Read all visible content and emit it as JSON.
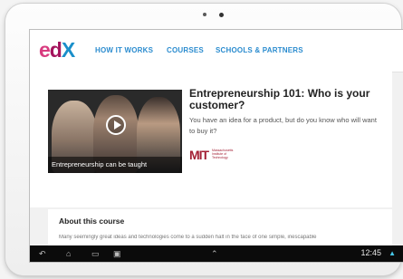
{
  "header": {
    "logo": {
      "e": "e",
      "d": "d",
      "x": "X"
    },
    "nav": [
      "HOW IT WORKS",
      "COURSES",
      "SCHOOLS & PARTNERS"
    ]
  },
  "course": {
    "video_caption": "Entrepreneurship can be taught",
    "title": "Entrepreneurship 101: Who is your customer?",
    "description": "You have an idea for a product, but do you know who will want to buy it?",
    "school_logo": {
      "mark": "MIT",
      "text": "Massachusetts Institute of Technology"
    }
  },
  "about": {
    "title": "About this course",
    "text": "Many seemingly great ideas and technologies come to a sudden halt in the face of one simple, inescapable"
  },
  "statusbar": {
    "time": "12:45",
    "icons": [
      "back-icon",
      "home-icon",
      "recent-apps-icon",
      "screenshot-icon",
      "up-arrow-icon"
    ]
  },
  "colors": {
    "accent": "#2b8ccf",
    "mit_red": "#a31f34",
    "system_bar": "#0b0b0b"
  }
}
